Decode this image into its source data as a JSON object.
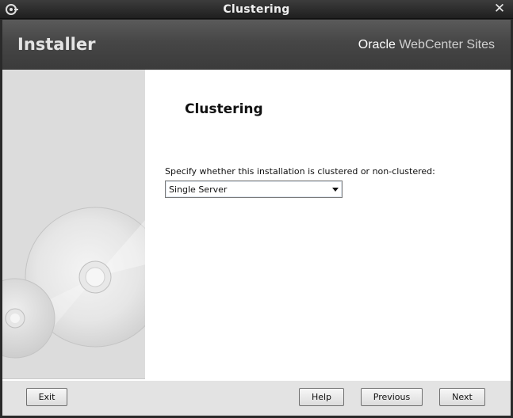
{
  "window": {
    "title": "Clustering"
  },
  "banner": {
    "installer": "Installer",
    "brand_oracle": "Oracle",
    "brand_product": "WebCenter Sites"
  },
  "page": {
    "title": "Clustering",
    "prompt": "Specify whether this installation is clustered or non-clustered:",
    "cluster_select": {
      "value": "Single Server"
    }
  },
  "footer": {
    "exit": "Exit",
    "help": "Help",
    "previous": "Previous",
    "next": "Next"
  }
}
